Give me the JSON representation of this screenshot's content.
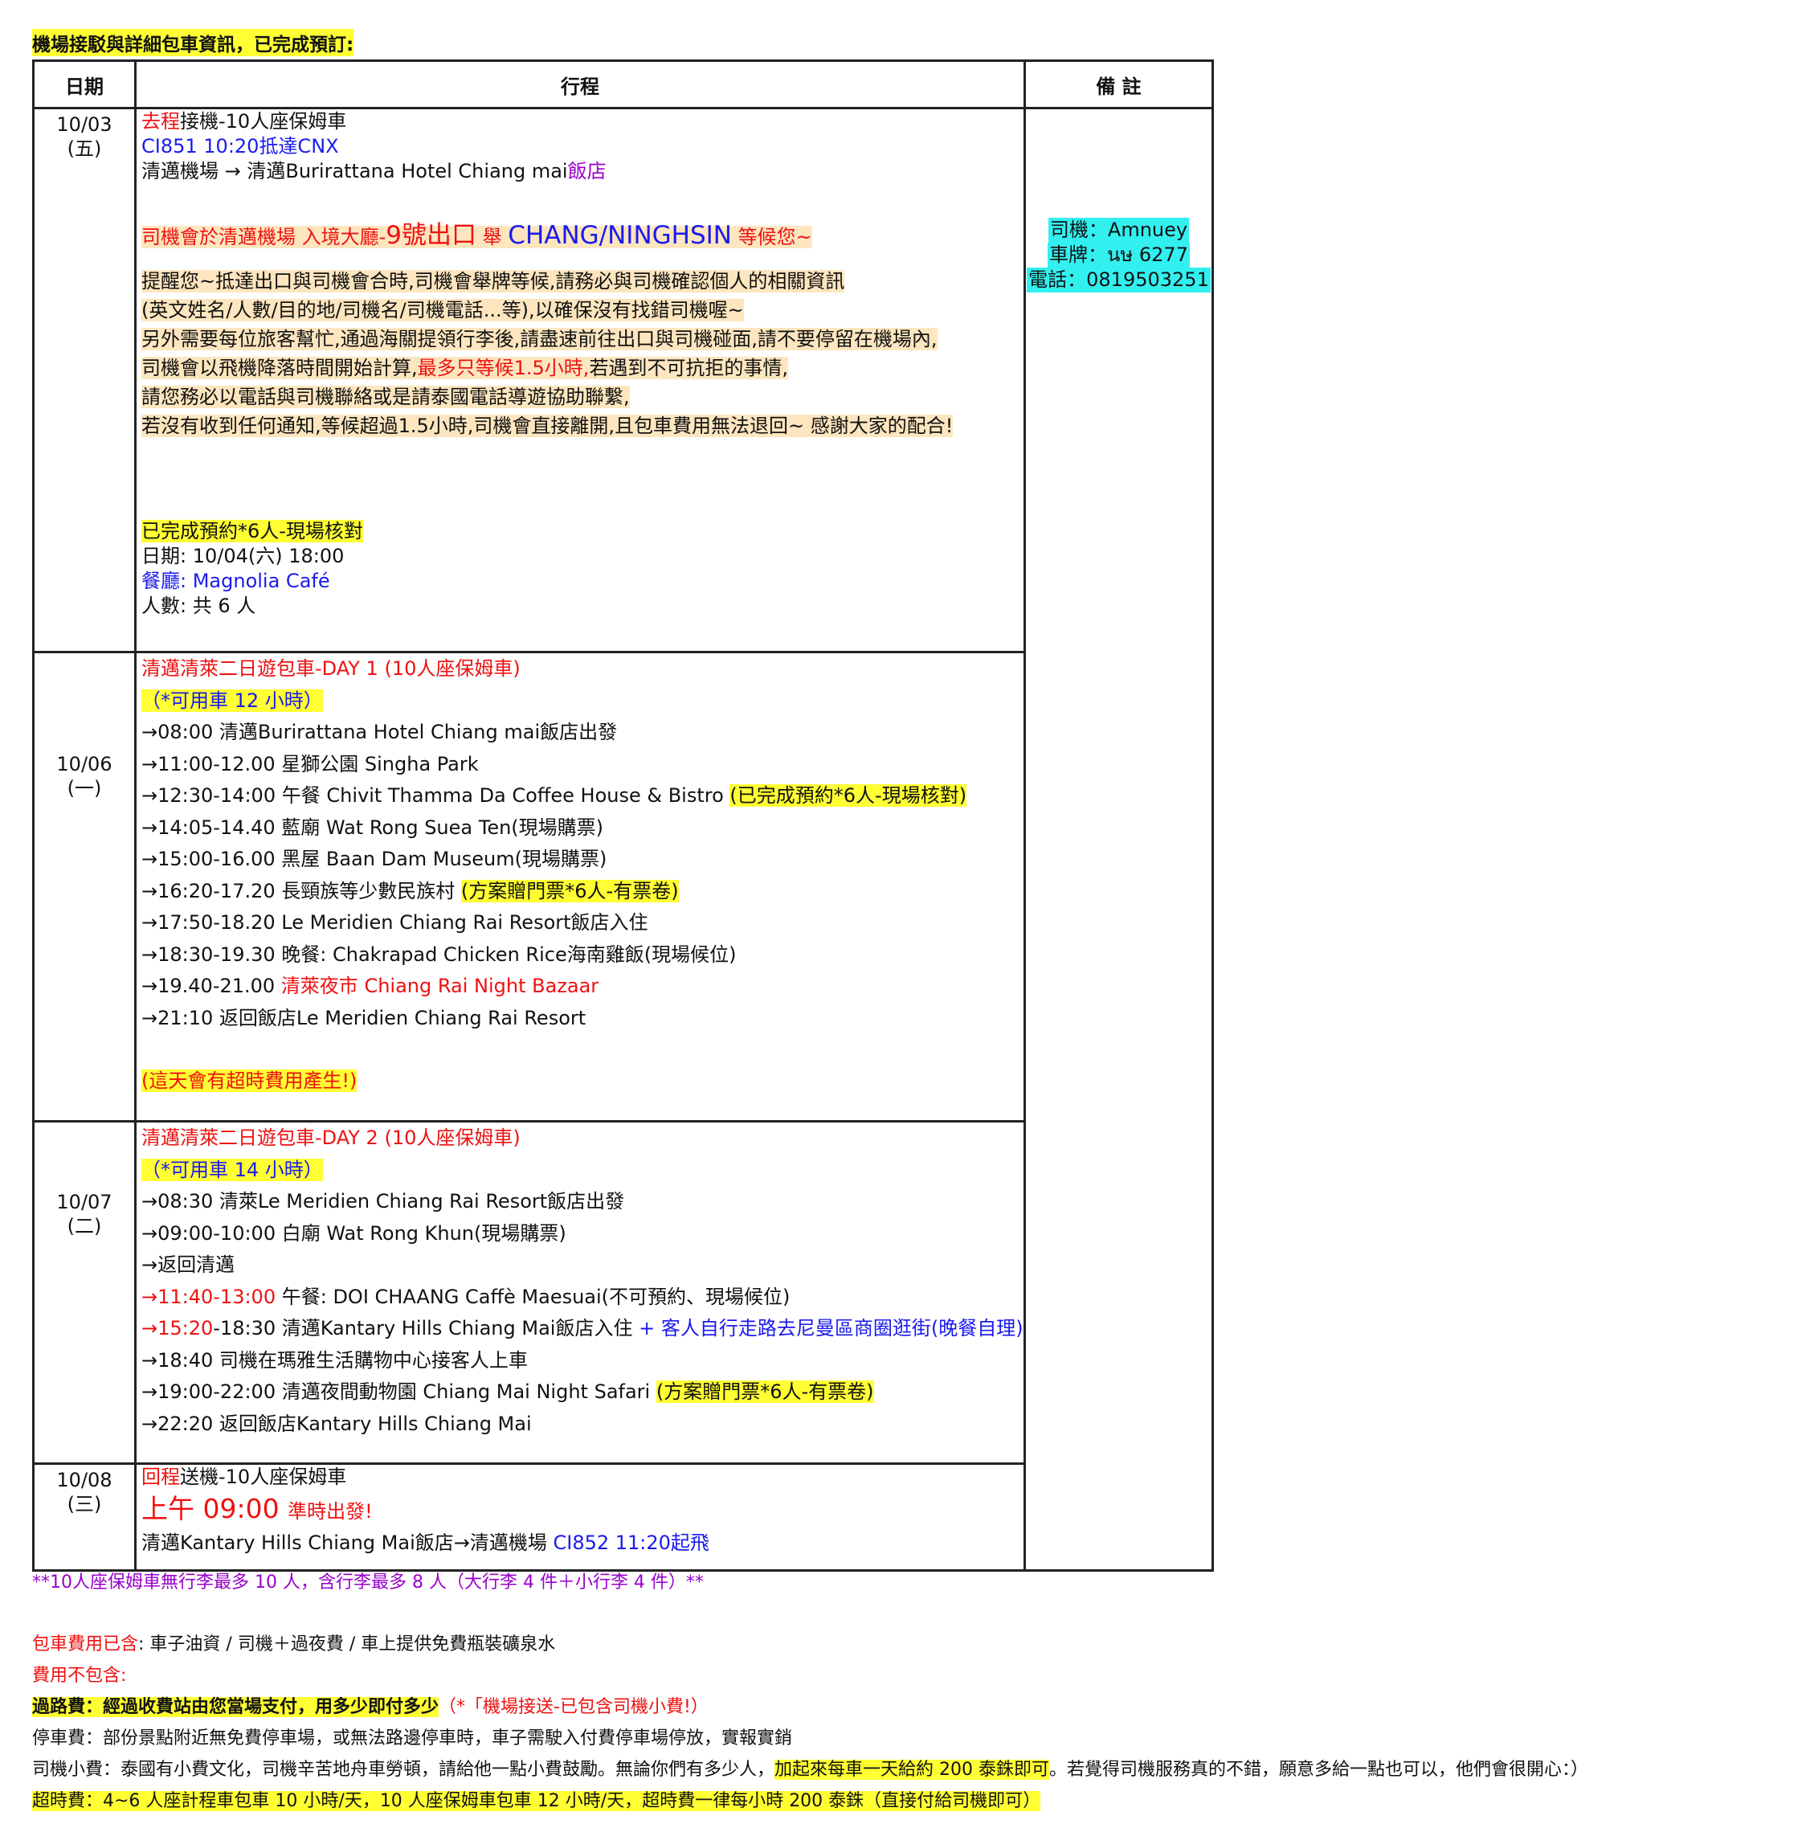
{
  "top_note": "機場接駁與詳細包車資訊，已完成預訂:",
  "headers": {
    "date": "日期",
    "itinerary": "行程",
    "notes": "備 註"
  },
  "driver": {
    "name": "司機：Amnuey",
    "plate": "車牌：นษ 6277",
    "phone": "電話：0819503251"
  },
  "day1": {
    "date": "10/03",
    "weekday": "(五)",
    "l1_a": "去程",
    "l1_b": "接機-10人座保姆車",
    "l2": "CI851 10:20抵達CNX",
    "l3_a": "清邁機場 → 清邁Burirattana Hotel Chiang mai",
    "l3_b": "飯店",
    "meet_a": "司機會於清邁機場 入境大廳-",
    "meet_b": "9號出口",
    "meet_c": " 舉 ",
    "meet_d": "CHANG/NINGHSIN",
    "meet_e": " 等候您~",
    "tip1": "提醒您~抵達出口與司機會合時,司機會舉牌等候,請務必與司機確認個人的相關資訊",
    "tip2": "(英文姓名/人數/目的地/司機名/司機電話...等),以確保沒有找錯司機喔~",
    "tip3": "另外需要每位旅客幫忙,通過海關提領行李後,請盡速前往出口與司機碰面,請不要停留在機場內,",
    "tip4_a": "司機會以飛機降落時間開始計算,",
    "tip4_b": "最多只等候1.5小時,",
    "tip4_c": "若遇到不可抗拒的事情,",
    "tip5": "請您務必以電話與司機聯絡或是請泰國電話導遊協助聯繫,",
    "tip6": "若沒有收到任何通知,等候超過1.5小時,司機會直接離開,且包車費用無法退回~ 感謝大家的配合!",
    "res_title": "已完成預約*6人-現場核對",
    "res_date": "日期: 10/04(六) 18:00",
    "res_rest_a": "餐廳",
    "res_rest_b": ": Magnolia Café",
    "res_people": "人數: 共 6 人"
  },
  "day2": {
    "date": "10/06",
    "weekday": "(一)",
    "title": "清邁清萊二日遊包車-DAY 1 (10人座保姆車)",
    "hours": "（*可用車 12 小時）",
    "i1": "→08:00 清邁Burirattana Hotel Chiang mai飯店出發",
    "i2": "→11:00-12.00 星獅公園 Singha Park",
    "i3_a": "→12:30-14:00 午餐 Chivit Thamma Da Coffee House & Bistro ",
    "i3_b": "(已完成預約*6人-現場核對)",
    "i4": "→14:05-14.40 藍廟 Wat Rong Suea Ten(現場購票)",
    "i5": "→15:00-16.00 黑屋 Baan Dam Museum(現場購票)",
    "i6_a": "→16:20-17.20 長頸族等少數民族村 ",
    "i6_b": "(方案贈門票*6人-有票卷)",
    "i7": "→17:50-18.20 Le Meridien Chiang Rai Resort飯店入住",
    "i8": "→18:30-19.30 晚餐: Chakrapad Chicken Rice海南雞飯(現場候位)",
    "i9_a": "→19.40-21.00 ",
    "i9_b": "清萊夜市 Chiang Rai Night Bazaar",
    "i10": "→21:10 返回飯店Le Meridien Chiang Rai Resort",
    "overtime": "(這天會有超時費用產生!)"
  },
  "day3": {
    "date": "10/07",
    "weekday": "(二)",
    "title": "清邁清萊二日遊包車-DAY 2 (10人座保姆車)",
    "hours": "（*可用車 14 小時）",
    "i1": "→08:30 清萊Le Meridien Chiang Rai Resort飯店出發",
    "i2": "→09:00-10:00  白廟 Wat Rong Khun(現場購票)",
    "i3": "→返回清邁",
    "i4_a": "→",
    "i4_b": "11:40-13:00",
    "i4_c": " 午餐: DOI CHAANG Caffè Maesuai(不可預約、現場候位)",
    "i5_a": "→",
    "i5_b": "15:20",
    "i5_c": "-18:30 清邁Kantary Hills Chiang Mai飯店入住 ",
    "i5_d": "+ 客人自行走路去尼曼區商圈逛街(晚餐自理)",
    "i6": "→18:40 司機在瑪雅生活購物中心接客人上車",
    "i7_a": "→19:00-22:00 清邁夜間動物園 Chiang Mai Night Safari ",
    "i7_b": "(方案贈門票*6人-有票卷)",
    "i8": "→22:20 返回飯店Kantary Hills Chiang Mai"
  },
  "day4": {
    "date": "10/08",
    "weekday": "(三)",
    "l1_a": "回程",
    "l1_b": "送機-10人座保姆車",
    "l2_a": "上午 09:00 ",
    "l2_b": "準時出發!",
    "l3_a": "清邁Kantary Hills Chiang Mai飯店→清邁機場     ",
    "l3_b": "CI852 11:20起飛"
  },
  "footer": {
    "luggage": "**10人座保姆車無行李最多 10 人，含行李最多 8 人（大行李 4 件＋小行李 4 件）**",
    "inc_a": "包車費用已含",
    "inc_b": ": 車子油資 / 司機＋過夜費 / 車上提供免費瓶裝礦泉水",
    "exc": "費用不包含:",
    "toll_a": "過路費：經過收費站由您當場支付，用多少即付多少",
    "toll_b": "（*「機場接送-已包含司機小費!）",
    "parking": "停車費：部份景點附近無免費停車場，或無法路邊停車時，車子需駛入付費停車場停放，實報實銷",
    "tip_a": "司機小費：泰國有小費文化，司機辛苦地舟車勞頓，請給他一點小費鼓勵。無論你們有多少人，",
    "tip_b": "加起來每車一天給約 200 泰銖即可",
    "tip_c": "。若覺得司機服務真的不錯，願意多給一點也可以，他們會很開心：）",
    "overtime": "超時費：4~6 人座計程車包車 10 小時/天，10 人座保姆車包車 12 小時/天，超時費一律每小時 200 泰銖（直接付給司機即可）"
  }
}
